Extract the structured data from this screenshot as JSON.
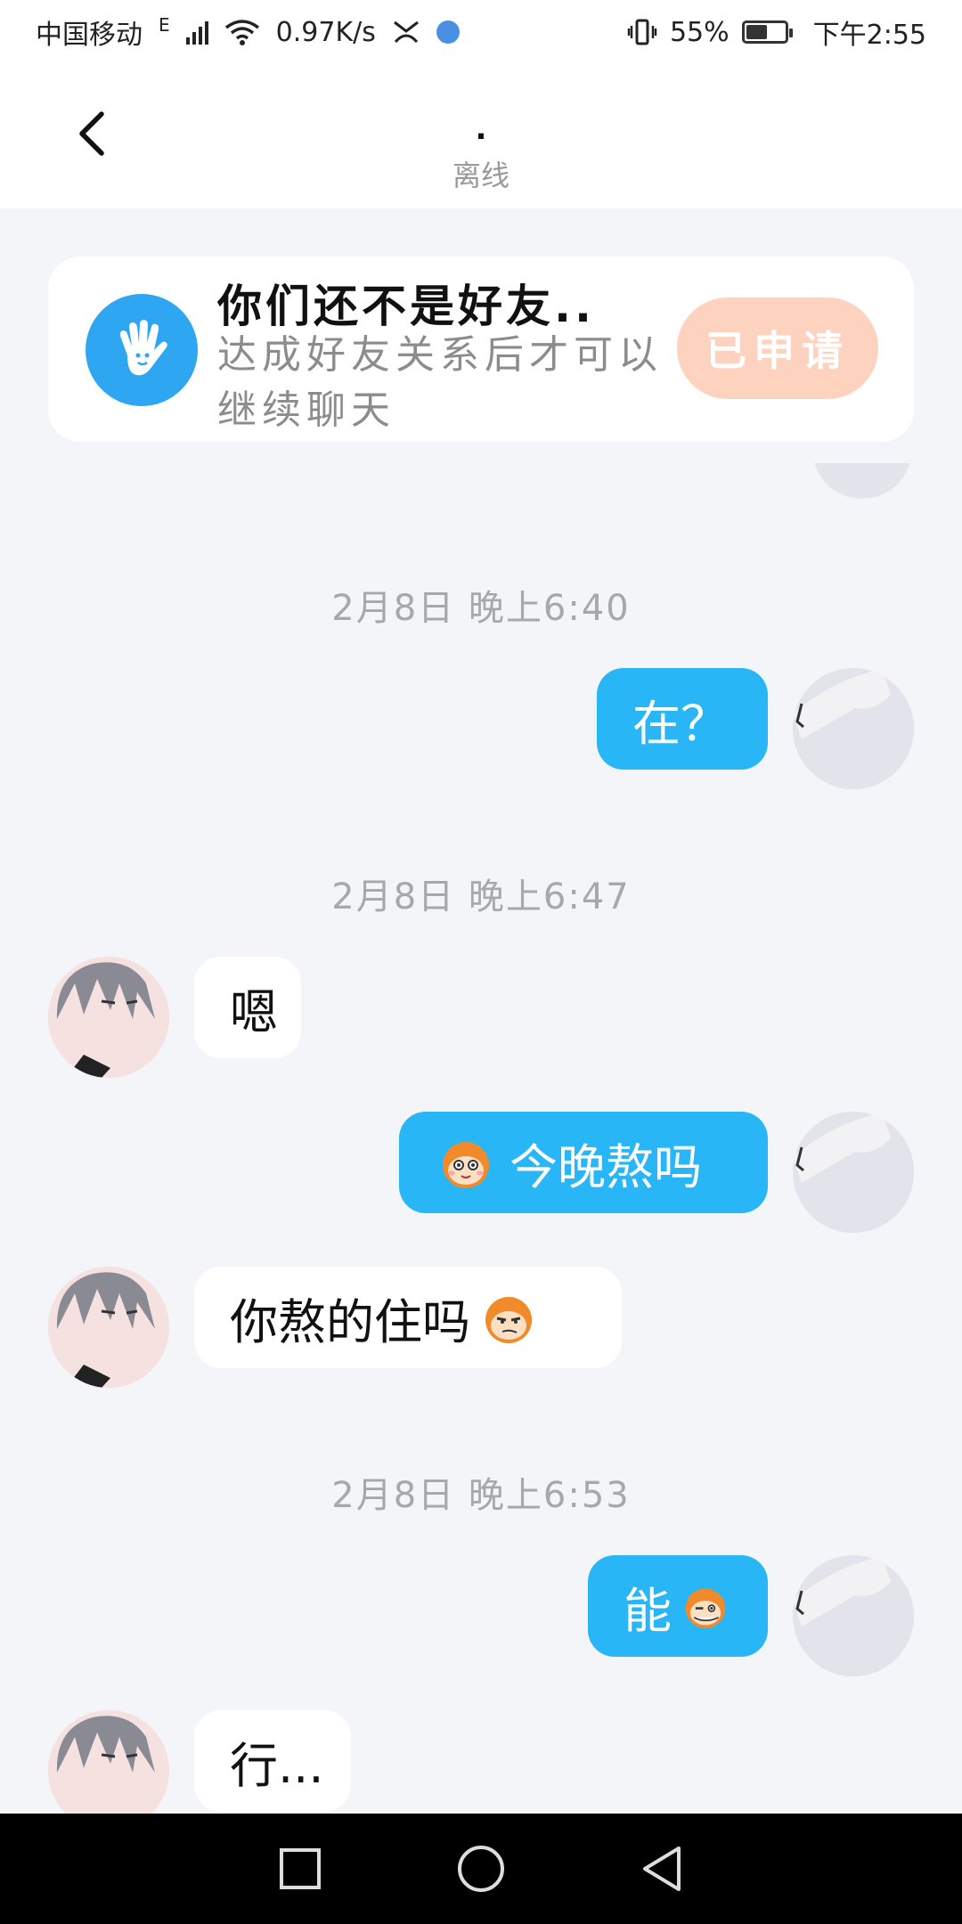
{
  "status_bar": {
    "carrier": "中国移动",
    "network_type": "E",
    "speed": "0.97K/s",
    "battery_percent": "55%",
    "battery_level": 0.55,
    "time": "下午2:55"
  },
  "header": {
    "title": ".",
    "subtitle": "离线"
  },
  "notice": {
    "title": "你们还不是好友..",
    "description": "达成好友关系后才可以继续聊天",
    "button_label": "已申请"
  },
  "messages": [
    {
      "type": "time",
      "text": "2月8日 晚上6:40"
    },
    {
      "type": "msg",
      "from": "me",
      "text": "在？"
    },
    {
      "type": "time",
      "text": "2月8日 晚上6:47"
    },
    {
      "type": "msg",
      "from": "peer",
      "text": "嗯"
    },
    {
      "type": "msg",
      "from": "me",
      "text": "今晚熬吗",
      "emoji": "monkey-smile-icon"
    },
    {
      "type": "msg",
      "from": "peer",
      "text": "你熬的住吗",
      "emoji": "monkey-smirk-icon"
    },
    {
      "type": "time",
      "text": "2月8日 晚上6:53"
    },
    {
      "type": "msg",
      "from": "me",
      "text": "能",
      "emoji": "monkey-wink-icon"
    },
    {
      "type": "msg",
      "from": "peer",
      "text": "行..."
    }
  ],
  "colors": {
    "my_bubble": "#29b6f6",
    "peer_bubble": "#ffffff",
    "applied_button": "#fdd3c0",
    "notice_icon": "#2fa6f2",
    "background": "#f3f5f8"
  }
}
